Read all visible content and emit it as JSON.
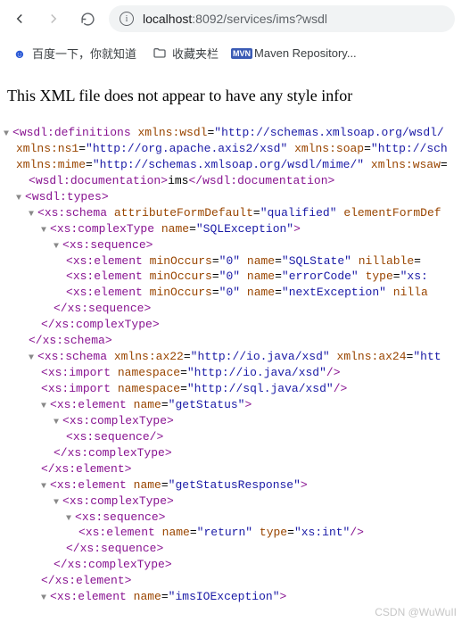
{
  "toolbar": {
    "url_host": "localhost",
    "url_port_path": ":8092/services/ims?wsdl"
  },
  "bookmarks": {
    "baidu": "百度一下，你就知道",
    "favbar": "收藏夹栏",
    "mvn_label": "MVN",
    "maven": "Maven Repository..."
  },
  "header": {
    "xml_notice": "This XML file does not appear to have any style infor"
  },
  "xml": {
    "l1_a": "<wsdl:definitions",
    "l1_attr1n": "xmlns:wsdl",
    "l1_attr1v": "\"http://schemas.xmlsoap.org/wsdl/",
    "l2_attr1n": "xmlns:ns1",
    "l2_attr1v": "\"http://org.apache.axis2/xsd\"",
    "l2_attr2n": "xmlns:soap",
    "l2_attr2v": "\"http://sch",
    "l3_attr1n": "xmlns:mime",
    "l3_attr1v": "\"http://schemas.xmlsoap.org/wsdl/mime/\"",
    "l3_attr2n": "xmlns:wsaw",
    "doc_open": "<wsdl:documentation>",
    "doc_text": "ims",
    "doc_close": "</wsdl:documentation>",
    "types_open": "<wsdl:types>",
    "schema1_open": "<xs:schema",
    "schema1_a1n": "attributeFormDefault",
    "schema1_a1v": "\"qualified\"",
    "schema1_a2n": "elementFormDef",
    "ct1_open": "<xs:complexType",
    "ct1_a1n": "name",
    "ct1_a1v": "\"SQLException\"",
    "seq_open": "<xs:sequence>",
    "el1": "<xs:element",
    "el1_a1n": "minOccurs",
    "el1_a1v": "\"0\"",
    "el1_a2n": "name",
    "el1_a2v": "\"SQLState\"",
    "el1_a3n": "nillable",
    "el2_a2v": "\"errorCode\"",
    "el2_a3n": "type",
    "el2_a3v": "\"xs:",
    "el3_a2v": "\"nextException\"",
    "el3_a3n": "nilla",
    "seq_close": "</xs:sequence>",
    "ct_close": "</xs:complexType>",
    "schema_close": "</xs:schema>",
    "schema2_open": "<xs:schema",
    "schema2_a1n": "xmlns:ax22",
    "schema2_a1v": "\"http://io.java/xsd\"",
    "schema2_a2n": "xmlns:ax24",
    "schema2_a2v": "\"htt",
    "import1": "<xs:import",
    "import1_an": "namespace",
    "import1_av": "\"http://io.java/xsd\"",
    "import2_av": "\"http://sql.java/xsd\"",
    "el_gs": "<xs:element",
    "el_gs_an": "name",
    "el_gs_av": "\"getStatus\"",
    "ct_plain_open": "<xs:complexType>",
    "seq_selfclose": "<xs:sequence/>",
    "el_close": "</xs:element>",
    "el_gsr_av": "\"getStatusResponse\"",
    "el_ret": "<xs:element",
    "el_ret_a1n": "name",
    "el_ret_a1v": "\"return\"",
    "el_ret_a2n": "type",
    "el_ret_a2v": "\"xs:int\"",
    "el_io_av": "\"imsIOException\""
  },
  "watermark": "CSDN @WuWuII"
}
